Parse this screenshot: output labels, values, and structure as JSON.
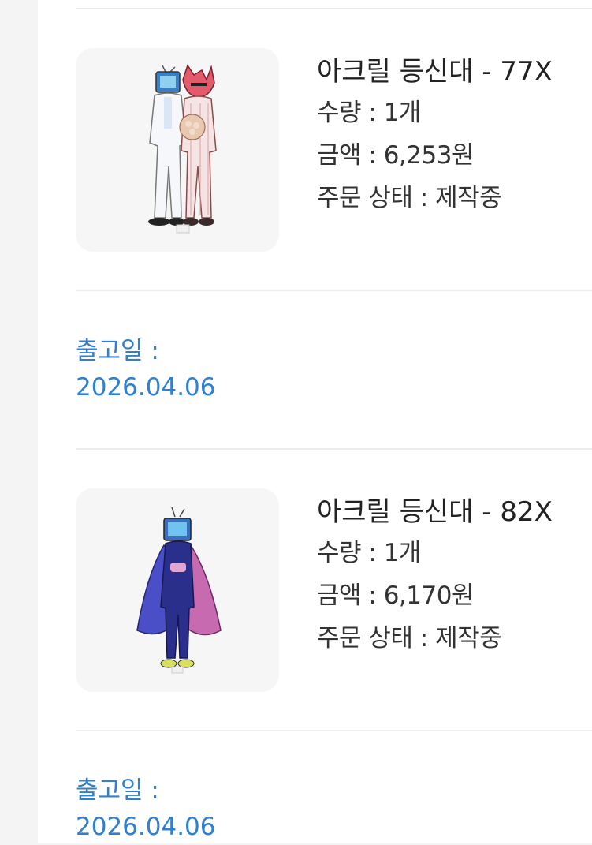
{
  "orders": [
    {
      "title": "아크릴 등신대 - 77X",
      "quantity": "수량 : 1개",
      "amount": "금액 : 6,253원",
      "status": "주문 상태 : 제작중",
      "ship_label": "출고일 :",
      "ship_date": "2026.04.06"
    },
    {
      "title": "아크릴 등신대 - 82X",
      "quantity": "수량 : 1개",
      "amount": "금액 : 6,170원",
      "status": "주문 상태 : 제작중",
      "ship_label": "출고일 :",
      "ship_date": "2026.04.06"
    }
  ],
  "colors": {
    "link_blue": "#2f80d1",
    "thumb_bg": "#f6f6f6",
    "divider": "#ececec"
  }
}
